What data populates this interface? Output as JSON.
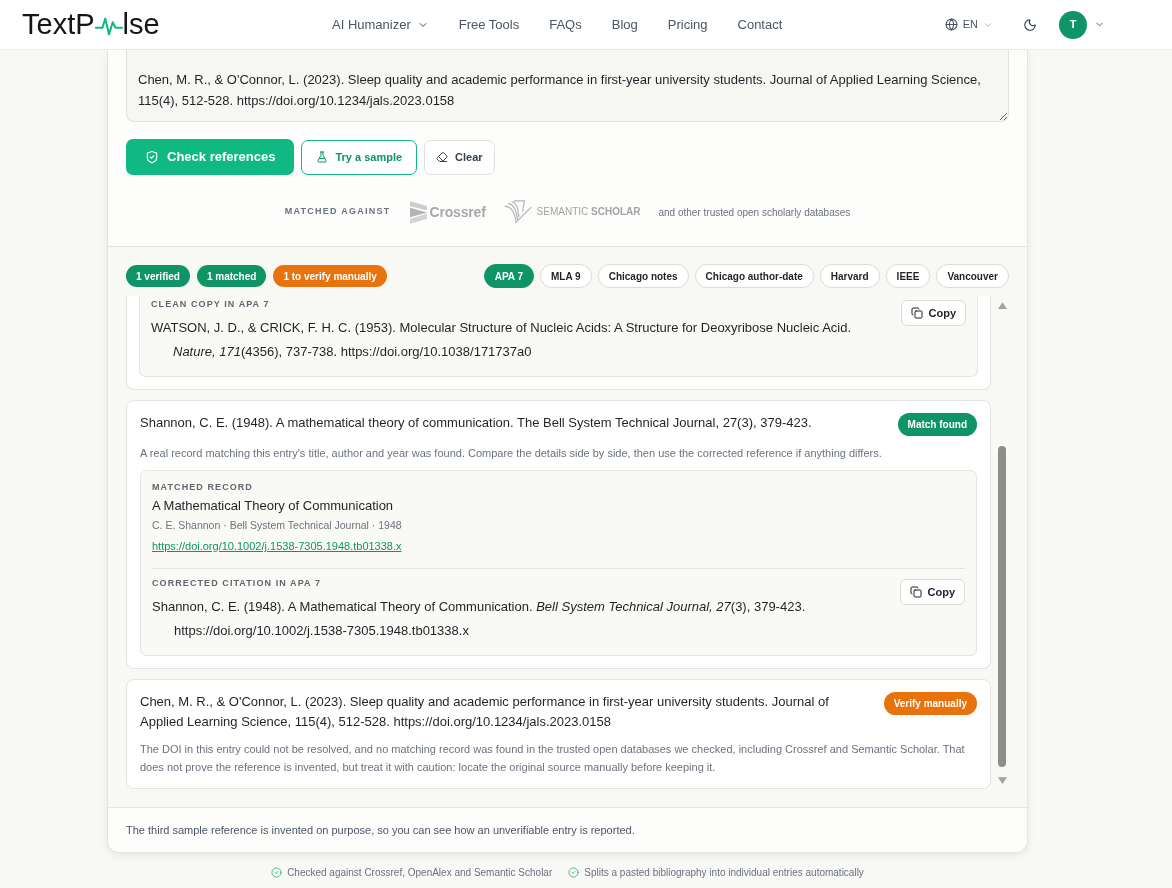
{
  "header": {
    "logo": {
      "before": "TextP",
      "after": "lse"
    },
    "nav": [
      {
        "label": "AI Humanizer",
        "has_menu": true
      },
      {
        "label": "Free Tools",
        "has_menu": false
      },
      {
        "label": "FAQs",
        "has_menu": false
      },
      {
        "label": "Blog",
        "has_menu": false
      },
      {
        "label": "Pricing",
        "has_menu": false
      },
      {
        "label": "Contact",
        "has_menu": false
      }
    ],
    "language": "EN",
    "avatar": "T"
  },
  "input": {
    "value": "Chen, M. R., & O'Connor, L. (2023). Sleep quality and academic performance in first-year university students. Journal of Applied Learning Science, 115(4), 512-528. https://doi.org/10.1234/jals.2023.0158"
  },
  "actions": [
    {
      "kind": "primary",
      "label": "Check references"
    },
    {
      "kind": "sample",
      "label": "Try a sample"
    },
    {
      "kind": "clear",
      "label": "Clear"
    }
  ],
  "sources": {
    "label": "MATCHED AGAINST",
    "logos": [
      {
        "kind": "crossref",
        "name": "Crossref"
      },
      {
        "kind": "semantic_scholar",
        "name": "SEMANTIC **SCHOLAR**"
      }
    ],
    "note": "and other trusted open scholarly databases"
  },
  "summary": [
    {
      "label": "1 verified",
      "color": "#0e9467"
    },
    {
      "label": "1 matched",
      "color": "#0e9467"
    },
    {
      "label": "1 to verify manually",
      "color": "#e8730c"
    }
  ],
  "styles": [
    {
      "label": "APA 7",
      "selected": true
    },
    {
      "label": "MLA 9",
      "selected": false
    },
    {
      "label": "Chicago notes",
      "selected": false
    },
    {
      "label": "Chicago author-date",
      "selected": false
    },
    {
      "label": "Harvard",
      "selected": false
    },
    {
      "label": "IEEE",
      "selected": false
    },
    {
      "label": "Vancouver",
      "selected": false
    }
  ],
  "results": [
    {
      "clean_copy": {
        "label": "CLEAN COPY IN APA 7",
        "citation": "WATSON, J. D., & CRICK, F. H. C. (1953). Molecular Structure of Nucleic Acids: A Structure for Deoxyribose Nucleic Acid. *Nature, 171*(4356), 737-738. https://doi.org/10.1038/171737a0",
        "copy": "Copy"
      }
    },
    {
      "citation": "Shannon, C. E. (1948). A mathematical theory of communication. The Bell System Technical Journal, 27(3), 379-423.",
      "status": {
        "label": "Match found",
        "color": "#0e9467"
      },
      "description": "A real record matching this entry's title, author and year was found. Compare the details side by side, then use the corrected reference if anything differs.",
      "record": {
        "label": "MATCHED RECORD",
        "title": "A Mathematical Theory of Communication",
        "meta": "C. E. Shannon · Bell System Technical Journal · 1948",
        "link": "https://doi.org/10.1002/j.1538-7305.1948.tb01338.x"
      },
      "corrected": {
        "label": "CORRECTED CITATION IN APA 7",
        "citation": "Shannon, C. E. (1948). A Mathematical Theory of Communication. *Bell System Technical Journal, 27*(3), 379-423. https://doi.org/10.1002/j.1538-7305.1948.tb01338.x",
        "copy": "Copy"
      }
    },
    {
      "citation": "Chen, M. R., & O'Connor, L. (2023). Sleep quality and academic performance in first-year university students. Journal of Applied Learning Science, 115(4), 512-528. https://doi.org/10.1234/jals.2023.0158",
      "status": {
        "label": "Verify manually",
        "color": "#e8730c"
      },
      "description": "The DOI in this entry could not be resolved, and no matching record was found in the trusted open databases we checked, including Crossref and Semantic Scholar. That does not prove the reference is invented, but treat it with caution: locate the original source manually before keeping it."
    }
  ],
  "footer_note": "The third sample reference is invented on purpose, so you can see how an unverifiable entry is reported.",
  "features": [
    "Checked against Crossref, OpenAlex and Semantic Scholar",
    "Splits a pasted bibliography into individual entries automatically"
  ]
}
